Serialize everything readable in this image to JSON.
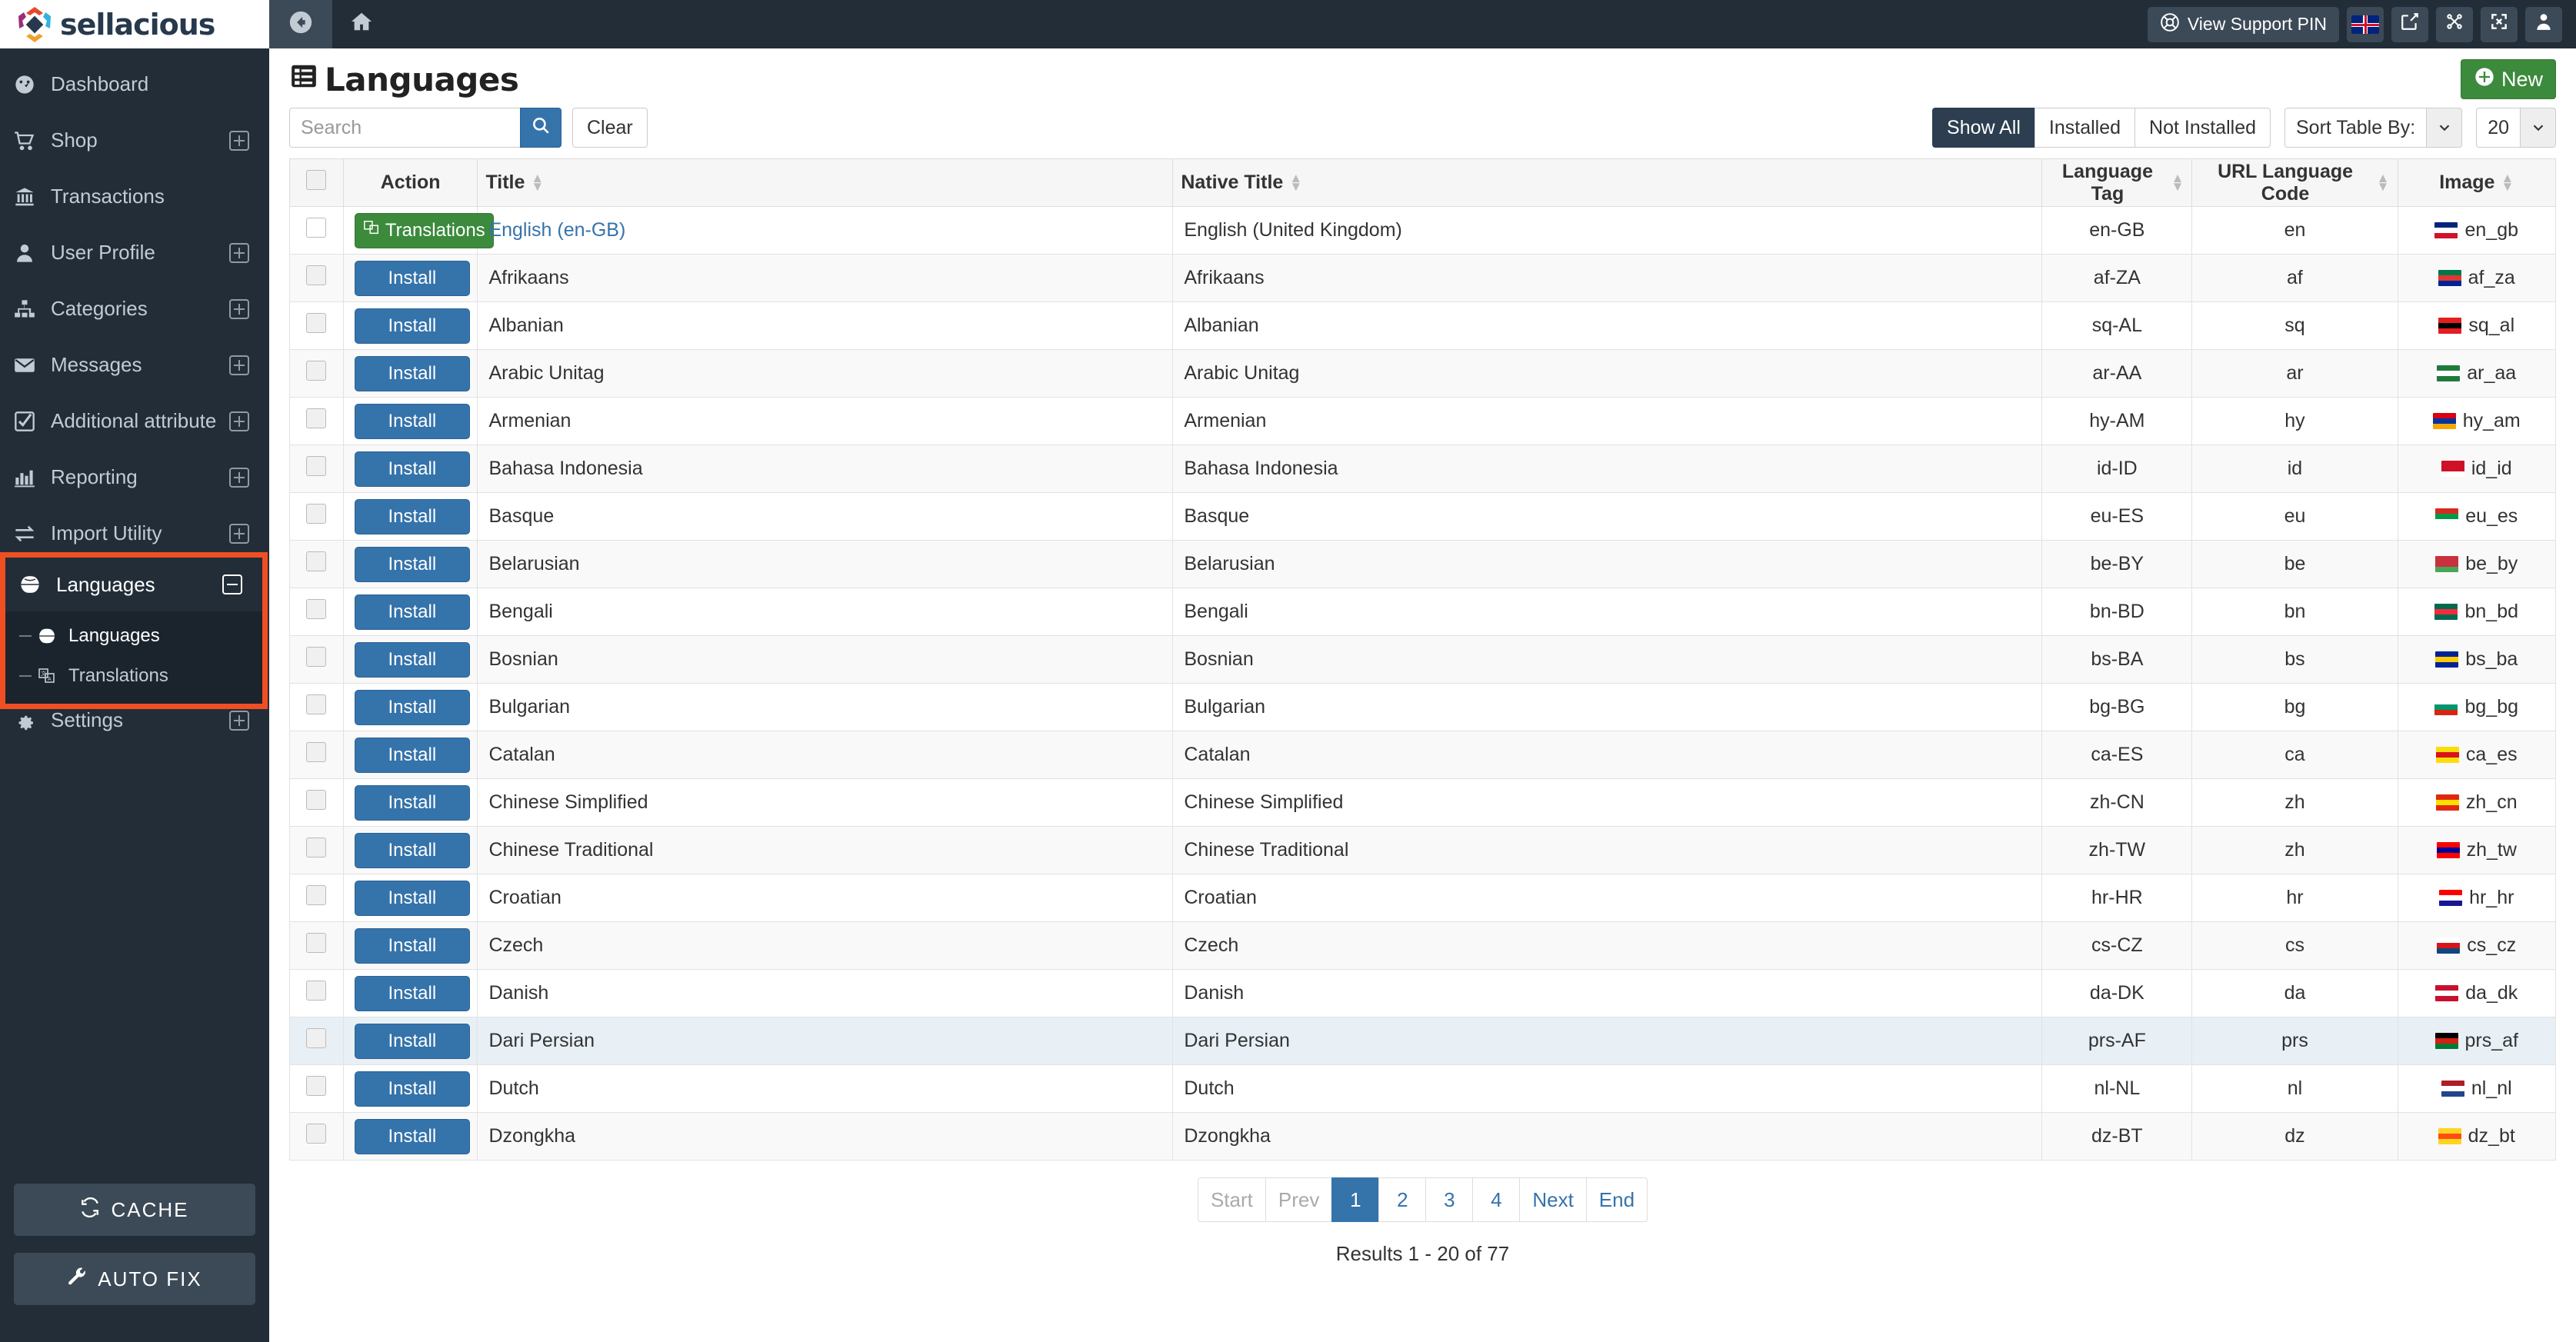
{
  "brand": {
    "name": "sellacious"
  },
  "topbar": {
    "back_icon": "arrow-circle-left-icon",
    "home_icon": "home-icon",
    "support_pin_label": "View Support PIN",
    "support_pin_icon": "lifebuoy-icon",
    "language_flag": "uk-flag-icon",
    "preview_icon": "external-link-icon",
    "joomla_icon": "joomla-icon",
    "fullscreen_icon": "expand-icon",
    "user_icon": "user-icon"
  },
  "sidebar": {
    "items": [
      {
        "label": "Dashboard",
        "icon": "dashboard-icon",
        "expandable": false
      },
      {
        "label": "Shop",
        "icon": "shopping-cart-icon",
        "expandable": true
      },
      {
        "label": "Transactions",
        "icon": "bank-icon",
        "expandable": false
      },
      {
        "label": "User Profile",
        "icon": "user-icon",
        "expandable": true
      },
      {
        "label": "Categories",
        "icon": "sitemap-icon",
        "expandable": true
      },
      {
        "label": "Messages",
        "icon": "envelope-icon",
        "expandable": true
      },
      {
        "label": "Additional attribute",
        "icon": "check-square-icon",
        "expandable": true
      },
      {
        "label": "Reporting",
        "icon": "bar-chart-icon",
        "expandable": true
      },
      {
        "label": "Import Utility",
        "icon": "exchange-icon",
        "expandable": true
      }
    ],
    "languages_group": {
      "label": "Languages",
      "icon": "globe-icon",
      "collapse_icon": "minus-square-icon",
      "children": [
        {
          "label": "Languages",
          "icon": "globe-icon",
          "active": true
        },
        {
          "label": "Translations",
          "icon": "translate-icon",
          "active": false
        }
      ]
    },
    "settings": {
      "label": "Settings",
      "icon": "gear-icon",
      "expandable": true
    },
    "cache_button": {
      "label": "CACHE",
      "icon": "refresh-icon"
    },
    "autofix_button": {
      "label": "AUTO FIX",
      "icon": "wrench-icon"
    }
  },
  "page": {
    "title": "Languages",
    "title_icon": "list-alt-icon",
    "new_button": {
      "label": "New",
      "icon": "plus-circle-icon"
    }
  },
  "search": {
    "placeholder": "Search",
    "value": "",
    "search_icon": "search-icon",
    "clear_label": "Clear"
  },
  "filters": {
    "buttons": [
      {
        "label": "Show All",
        "active": true
      },
      {
        "label": "Installed",
        "active": false
      },
      {
        "label": "Not Installed",
        "active": false
      }
    ],
    "sort_label": "Sort Table By:",
    "limit_value": "20",
    "caret_icon": "chevron-down-icon"
  },
  "table": {
    "columns": [
      {
        "key": "checkbox",
        "label": "",
        "sortable": false
      },
      {
        "key": "action",
        "label": "Action",
        "sortable": false
      },
      {
        "key": "title",
        "label": "Title",
        "sortable": true
      },
      {
        "key": "native_title",
        "label": "Native Title",
        "sortable": true
      },
      {
        "key": "language_tag",
        "label": "Language Tag",
        "sortable": true
      },
      {
        "key": "url_language_code",
        "label": "URL Language Code",
        "sortable": true
      },
      {
        "key": "image",
        "label": "Image",
        "sortable": true
      }
    ],
    "rows": [
      {
        "action": "Translations",
        "action_type": "translations",
        "title": "English (en-GB)",
        "title_link": true,
        "native_title": "English (United Kingdom)",
        "language_tag": "en-GB",
        "url_language_code": "en",
        "image": "en_gb",
        "flag": [
          "#00247d",
          "#ffffff",
          "#cf142b"
        ],
        "highlight": false
      },
      {
        "action": "Install",
        "action_type": "install",
        "title": "Afrikaans",
        "title_link": false,
        "native_title": "Afrikaans",
        "language_tag": "af-ZA",
        "url_language_code": "af",
        "image": "af_za",
        "flag": [
          "#007749",
          "#de3831",
          "#002395"
        ],
        "highlight": false
      },
      {
        "action": "Install",
        "action_type": "install",
        "title": "Albanian",
        "title_link": false,
        "native_title": "Albanian",
        "language_tag": "sq-AL",
        "url_language_code": "sq",
        "image": "sq_al",
        "flag": [
          "#e41e20",
          "#000000",
          "#e41e20"
        ],
        "highlight": false
      },
      {
        "action": "Install",
        "action_type": "install",
        "title": "Arabic Unitag",
        "title_link": false,
        "native_title": "Arabic Unitag",
        "language_tag": "ar-AA",
        "url_language_code": "ar",
        "image": "ar_aa",
        "flag": [
          "#1f7a3d",
          "#ffffff",
          "#1f7a3d"
        ],
        "highlight": false
      },
      {
        "action": "Install",
        "action_type": "install",
        "title": "Armenian",
        "title_link": false,
        "native_title": "Armenian",
        "language_tag": "hy-AM",
        "url_language_code": "hy",
        "image": "hy_am",
        "flag": [
          "#d90012",
          "#0033a0",
          "#f2a800"
        ],
        "highlight": false
      },
      {
        "action": "Install",
        "action_type": "install",
        "title": "Bahasa Indonesia",
        "title_link": false,
        "native_title": "Bahasa Indonesia",
        "language_tag": "id-ID",
        "url_language_code": "id",
        "image": "id_id",
        "flag": [
          "#ce1126",
          "#ce1126",
          "#ffffff"
        ],
        "highlight": false
      },
      {
        "action": "Install",
        "action_type": "install",
        "title": "Basque",
        "title_link": false,
        "native_title": "Basque",
        "language_tag": "eu-ES",
        "url_language_code": "eu",
        "image": "eu_es",
        "flag": [
          "#d52b1e",
          "#009b48",
          "#ffffff"
        ],
        "highlight": false
      },
      {
        "action": "Install",
        "action_type": "install",
        "title": "Belarusian",
        "title_link": false,
        "native_title": "Belarusian",
        "language_tag": "be-BY",
        "url_language_code": "be",
        "image": "be_by",
        "flag": [
          "#c8313e",
          "#c8313e",
          "#4aa657"
        ],
        "highlight": false
      },
      {
        "action": "Install",
        "action_type": "install",
        "title": "Bengali",
        "title_link": false,
        "native_title": "Bengali",
        "language_tag": "bn-BD",
        "url_language_code": "bn",
        "image": "bn_bd",
        "flag": [
          "#006a4e",
          "#f42a41",
          "#006a4e"
        ],
        "highlight": false
      },
      {
        "action": "Install",
        "action_type": "install",
        "title": "Bosnian",
        "title_link": false,
        "native_title": "Bosnian",
        "language_tag": "bs-BA",
        "url_language_code": "bs",
        "image": "bs_ba",
        "flag": [
          "#002395",
          "#fecb00",
          "#002395"
        ],
        "highlight": false
      },
      {
        "action": "Install",
        "action_type": "install",
        "title": "Bulgarian",
        "title_link": false,
        "native_title": "Bulgarian",
        "language_tag": "bg-BG",
        "url_language_code": "bg",
        "image": "bg_bg",
        "flag": [
          "#ffffff",
          "#00966e",
          "#d62612"
        ],
        "highlight": false
      },
      {
        "action": "Install",
        "action_type": "install",
        "title": "Catalan",
        "title_link": false,
        "native_title": "Catalan",
        "language_tag": "ca-ES",
        "url_language_code": "ca",
        "image": "ca_es",
        "flag": [
          "#fcdd09",
          "#da121a",
          "#fcdd09"
        ],
        "highlight": false
      },
      {
        "action": "Install",
        "action_type": "install",
        "title": "Chinese Simplified",
        "title_link": false,
        "native_title": "Chinese Simplified",
        "language_tag": "zh-CN",
        "url_language_code": "zh",
        "image": "zh_cn",
        "flag": [
          "#de2910",
          "#ffde00",
          "#de2910"
        ],
        "highlight": false
      },
      {
        "action": "Install",
        "action_type": "install",
        "title": "Chinese Traditional",
        "title_link": false,
        "native_title": "Chinese Traditional",
        "language_tag": "zh-TW",
        "url_language_code": "zh",
        "image": "zh_tw",
        "flag": [
          "#fe0000",
          "#000095",
          "#fe0000"
        ],
        "highlight": false
      },
      {
        "action": "Install",
        "action_type": "install",
        "title": "Croatian",
        "title_link": false,
        "native_title": "Croatian",
        "language_tag": "hr-HR",
        "url_language_code": "hr",
        "image": "hr_hr",
        "flag": [
          "#ff0000",
          "#ffffff",
          "#171796"
        ],
        "highlight": false
      },
      {
        "action": "Install",
        "action_type": "install",
        "title": "Czech",
        "title_link": false,
        "native_title": "Czech",
        "language_tag": "cs-CZ",
        "url_language_code": "cs",
        "image": "cs_cz",
        "flag": [
          "#ffffff",
          "#d7141a",
          "#11457e"
        ],
        "highlight": false
      },
      {
        "action": "Install",
        "action_type": "install",
        "title": "Danish",
        "title_link": false,
        "native_title": "Danish",
        "language_tag": "da-DK",
        "url_language_code": "da",
        "image": "da_dk",
        "flag": [
          "#c8102e",
          "#ffffff",
          "#c8102e"
        ],
        "highlight": false
      },
      {
        "action": "Install",
        "action_type": "install",
        "title": "Dari Persian",
        "title_link": false,
        "native_title": "Dari Persian",
        "language_tag": "prs-AF",
        "url_language_code": "prs",
        "image": "prs_af",
        "flag": [
          "#000000",
          "#d32011",
          "#007a36"
        ],
        "highlight": true
      },
      {
        "action": "Install",
        "action_type": "install",
        "title": "Dutch",
        "title_link": false,
        "native_title": "Dutch",
        "language_tag": "nl-NL",
        "url_language_code": "nl",
        "image": "nl_nl",
        "flag": [
          "#ae1c28",
          "#ffffff",
          "#21468b"
        ],
        "highlight": false
      },
      {
        "action": "Install",
        "action_type": "install",
        "title": "Dzongkha",
        "title_link": false,
        "native_title": "Dzongkha",
        "language_tag": "dz-BT",
        "url_language_code": "dz",
        "image": "dz_bt",
        "flag": [
          "#ffd520",
          "#ff4e12",
          "#ffd520"
        ],
        "highlight": false
      }
    ]
  },
  "pagination": {
    "items": [
      {
        "label": "Start",
        "state": "disabled"
      },
      {
        "label": "Prev",
        "state": "disabled"
      },
      {
        "label": "1",
        "state": "active"
      },
      {
        "label": "2",
        "state": "normal"
      },
      {
        "label": "3",
        "state": "normal"
      },
      {
        "label": "4",
        "state": "normal"
      },
      {
        "label": "Next",
        "state": "normal"
      },
      {
        "label": "End",
        "state": "normal"
      }
    ],
    "results_text": "Results 1 - 20 of 77"
  },
  "colors": {
    "sidebar_bg": "#222d38",
    "accent_blue": "#3573ab",
    "accent_green": "#3c8a3c",
    "highlight_red": "#f04e23",
    "row_highlight": "#e8f0f6"
  }
}
